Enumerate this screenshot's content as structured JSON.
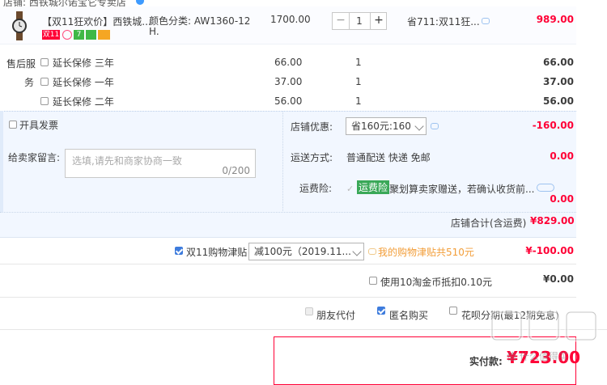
{
  "shop": {
    "name_partial": "店铺: 西铁城尔诺宝它专卖店"
  },
  "item": {
    "title": "【双11狂欢价】西铁城...",
    "sku_line1": "颜色分类: AW1360-12",
    "sku_line2": "H.",
    "price": "1700.00",
    "qty": "1",
    "discount": "省711:双11狂...",
    "total": "989.00",
    "badge_double11": "双11",
    "badge_num": "7"
  },
  "service": {
    "label_a": "售后服",
    "label_b": "务",
    "rows": [
      {
        "label": "延长保修 三年",
        "price": "66.00",
        "qty": "1",
        "total": "66.00"
      },
      {
        "label": "延长保修 一年",
        "price": "37.00",
        "qty": "1",
        "total": "37.00"
      },
      {
        "label": "延长保修 二年",
        "price": "56.00",
        "qty": "1",
        "total": "56.00"
      }
    ]
  },
  "invoice": {
    "label": "开具发票"
  },
  "shop_discount": {
    "label": "店铺优惠:",
    "selected": "省160元:160",
    "amount": "-160.00"
  },
  "message": {
    "label": "给卖家留言:",
    "placeholder": "选填,请先和商家协商一致",
    "counter": "0/200"
  },
  "shipping": {
    "label": "运送方式:",
    "value": "普通配送 快递 免邮",
    "amount": "0.00"
  },
  "insurance": {
    "label": "运费险:",
    "tag": "运费险",
    "desc": "聚划算卖家赠送，若确认收货前...",
    "amount": "0.00"
  },
  "shop_total": {
    "label": "店铺合计(含运费)",
    "amount": "¥829.00"
  },
  "allowance": {
    "label": "双11购物津贴",
    "selected": "减100元（2019.11...",
    "note": "我的购物津贴共510元",
    "amount": "¥-100.00"
  },
  "coins": {
    "label": "使用10淘金币抵扣0.10元",
    "amount": "¥0.00"
  },
  "options": {
    "friend_pay": "朋友代付",
    "anonymous": "匿名购买",
    "huabei": "花呗分期(最12期免息)"
  },
  "summary": {
    "label": "实付款:",
    "amount": "¥723.00"
  },
  "watermark": "值 什么值得买"
}
